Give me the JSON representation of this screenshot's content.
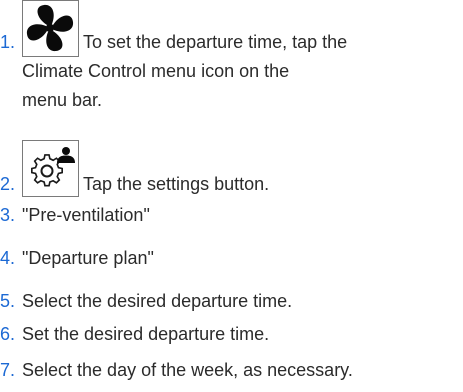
{
  "steps": [
    {
      "number": "1.",
      "text_line1": "To set the departure time, tap the",
      "text_rest": "Climate Control menu icon on the menu bar.",
      "icon": "fan-icon"
    },
    {
      "number": "2.",
      "text": "Tap the settings button.",
      "icon": "gear-settings-icon"
    },
    {
      "number": "3.",
      "text": "\"Pre-ventilation\""
    },
    {
      "number": "4.",
      "text": "\"Departure plan\""
    },
    {
      "number": "5.",
      "text": "Select the desired departure time."
    },
    {
      "number": "6.",
      "text": "Set the desired departure time."
    },
    {
      "number": "7.",
      "text": "Select the day of the week, as necessary."
    }
  ],
  "colors": {
    "number": "#1c69d4",
    "text": "#2b2b2b",
    "icon_border": "#7a7a7a"
  }
}
